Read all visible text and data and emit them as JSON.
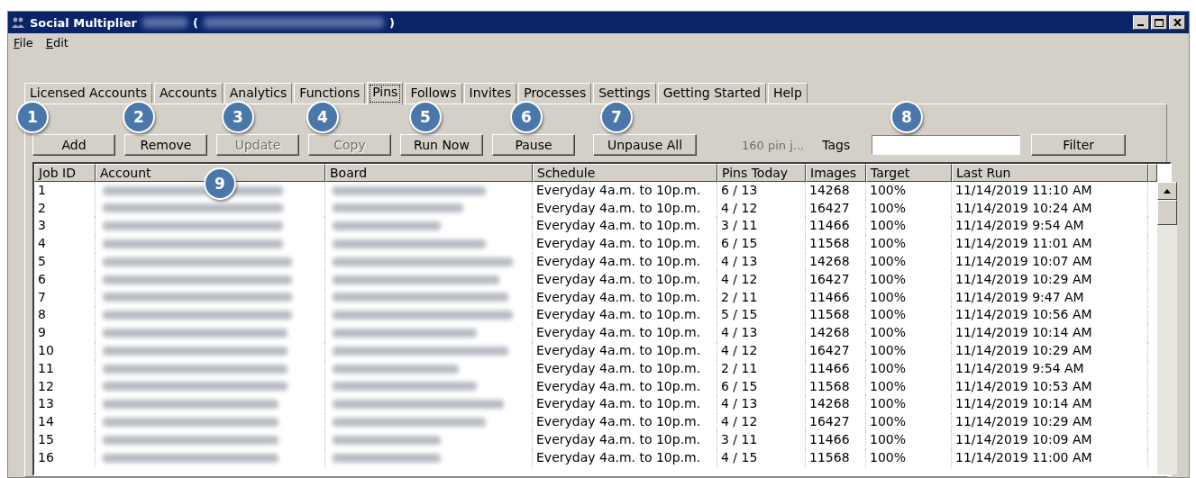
{
  "window": {
    "title": "Social Multiplier",
    "title_paren_open": "(",
    "title_paren_close": ")"
  },
  "menu": [
    {
      "label": "File"
    },
    {
      "label": "Edit"
    }
  ],
  "tabs": [
    {
      "label": "Licensed Accounts",
      "selected": false
    },
    {
      "label": "Accounts",
      "selected": false
    },
    {
      "label": "Analytics",
      "selected": false
    },
    {
      "label": "Functions",
      "selected": false
    },
    {
      "label": "Pins",
      "selected": true
    },
    {
      "label": "Follows",
      "selected": false
    },
    {
      "label": "Invites",
      "selected": false
    },
    {
      "label": "Processes",
      "selected": false
    },
    {
      "label": "Settings",
      "selected": false
    },
    {
      "label": "Getting Started",
      "selected": false
    },
    {
      "label": "Help",
      "selected": false
    }
  ],
  "toolbar": {
    "buttons": [
      {
        "label": "Add",
        "disabled": false
      },
      {
        "label": "Remove",
        "disabled": false
      },
      {
        "label": "Update",
        "disabled": true
      },
      {
        "label": "Copy",
        "disabled": true
      },
      {
        "label": "Run Now",
        "disabled": false
      },
      {
        "label": "Pause",
        "disabled": false
      },
      {
        "label": "Unpause All",
        "disabled": false
      }
    ],
    "status": "160 pin j...",
    "tags_label": "Tags",
    "filter_button": "Filter"
  },
  "table": {
    "columns": [
      "Job ID",
      "Account",
      "Board",
      "Schedule",
      "Pins Today",
      "Images",
      "Target",
      "Last Run"
    ],
    "rows": [
      {
        "job_id": "1",
        "schedule": "Everyday 4a.m.  to 10p.m.",
        "pins_today": "6  / 13",
        "images": "14268",
        "target": "100%",
        "last_run": "11/14/2019 11:10 AM"
      },
      {
        "job_id": "2",
        "schedule": "Everyday 4a.m.  to 10p.m.",
        "pins_today": "4  / 12",
        "images": "16427",
        "target": "100%",
        "last_run": "11/14/2019 10:24 AM"
      },
      {
        "job_id": "3",
        "schedule": "Everyday 4a.m.  to 10p.m.",
        "pins_today": "3  / 11",
        "images": "11466",
        "target": "100%",
        "last_run": "11/14/2019 9:54 AM"
      },
      {
        "job_id": "4",
        "schedule": "Everyday 4a.m.  to 10p.m.",
        "pins_today": "6  / 15",
        "images": "11568",
        "target": "100%",
        "last_run": "11/14/2019 11:01 AM"
      },
      {
        "job_id": "5",
        "schedule": "Everyday 4a.m.  to 10p.m.",
        "pins_today": "4  / 13",
        "images": "14268",
        "target": "100%",
        "last_run": "11/14/2019 10:07 AM"
      },
      {
        "job_id": "6",
        "schedule": "Everyday 4a.m.  to 10p.m.",
        "pins_today": "4  / 12",
        "images": "16427",
        "target": "100%",
        "last_run": "11/14/2019 10:29 AM"
      },
      {
        "job_id": "7",
        "schedule": "Everyday 4a.m.  to 10p.m.",
        "pins_today": "2  / 11",
        "images": "11466",
        "target": "100%",
        "last_run": "11/14/2019 9:47 AM"
      },
      {
        "job_id": "8",
        "schedule": "Everyday 4a.m.  to 10p.m.",
        "pins_today": "5  / 15",
        "images": "11568",
        "target": "100%",
        "last_run": "11/14/2019 10:56 AM"
      },
      {
        "job_id": "9",
        "schedule": "Everyday 4a.m.  to 10p.m.",
        "pins_today": "4  / 13",
        "images": "14268",
        "target": "100%",
        "last_run": "11/14/2019 10:14 AM"
      },
      {
        "job_id": "10",
        "schedule": "Everyday 4a.m.  to 10p.m.",
        "pins_today": "4  / 12",
        "images": "16427",
        "target": "100%",
        "last_run": "11/14/2019 10:29 AM"
      },
      {
        "job_id": "11",
        "schedule": "Everyday 4a.m.  to 10p.m.",
        "pins_today": "2  / 11",
        "images": "11466",
        "target": "100%",
        "last_run": "11/14/2019 9:54 AM"
      },
      {
        "job_id": "12",
        "schedule": "Everyday 4a.m.  to 10p.m.",
        "pins_today": "6  / 15",
        "images": "11568",
        "target": "100%",
        "last_run": "11/14/2019 10:53 AM"
      },
      {
        "job_id": "13",
        "schedule": "Everyday 4a.m.  to 10p.m.",
        "pins_today": "4  / 13",
        "images": "14268",
        "target": "100%",
        "last_run": "11/14/2019 10:14 AM"
      },
      {
        "job_id": "14",
        "schedule": "Everyday 4a.m.  to 10p.m.",
        "pins_today": "4  / 12",
        "images": "16427",
        "target": "100%",
        "last_run": "11/14/2019 10:29 AM"
      },
      {
        "job_id": "15",
        "schedule": "Everyday 4a.m.  to 10p.m.",
        "pins_today": "3  / 11",
        "images": "11466",
        "target": "100%",
        "last_run": "11/14/2019 10:09 AM"
      },
      {
        "job_id": "16",
        "schedule": "Everyday 4a.m.  to 10p.m.",
        "pins_today": "4  / 15",
        "images": "11568",
        "target": "100%",
        "last_run": "11/14/2019 11:00 AM"
      }
    ]
  },
  "callouts": [
    "1",
    "2",
    "3",
    "4",
    "5",
    "6",
    "7",
    "8",
    "9"
  ]
}
